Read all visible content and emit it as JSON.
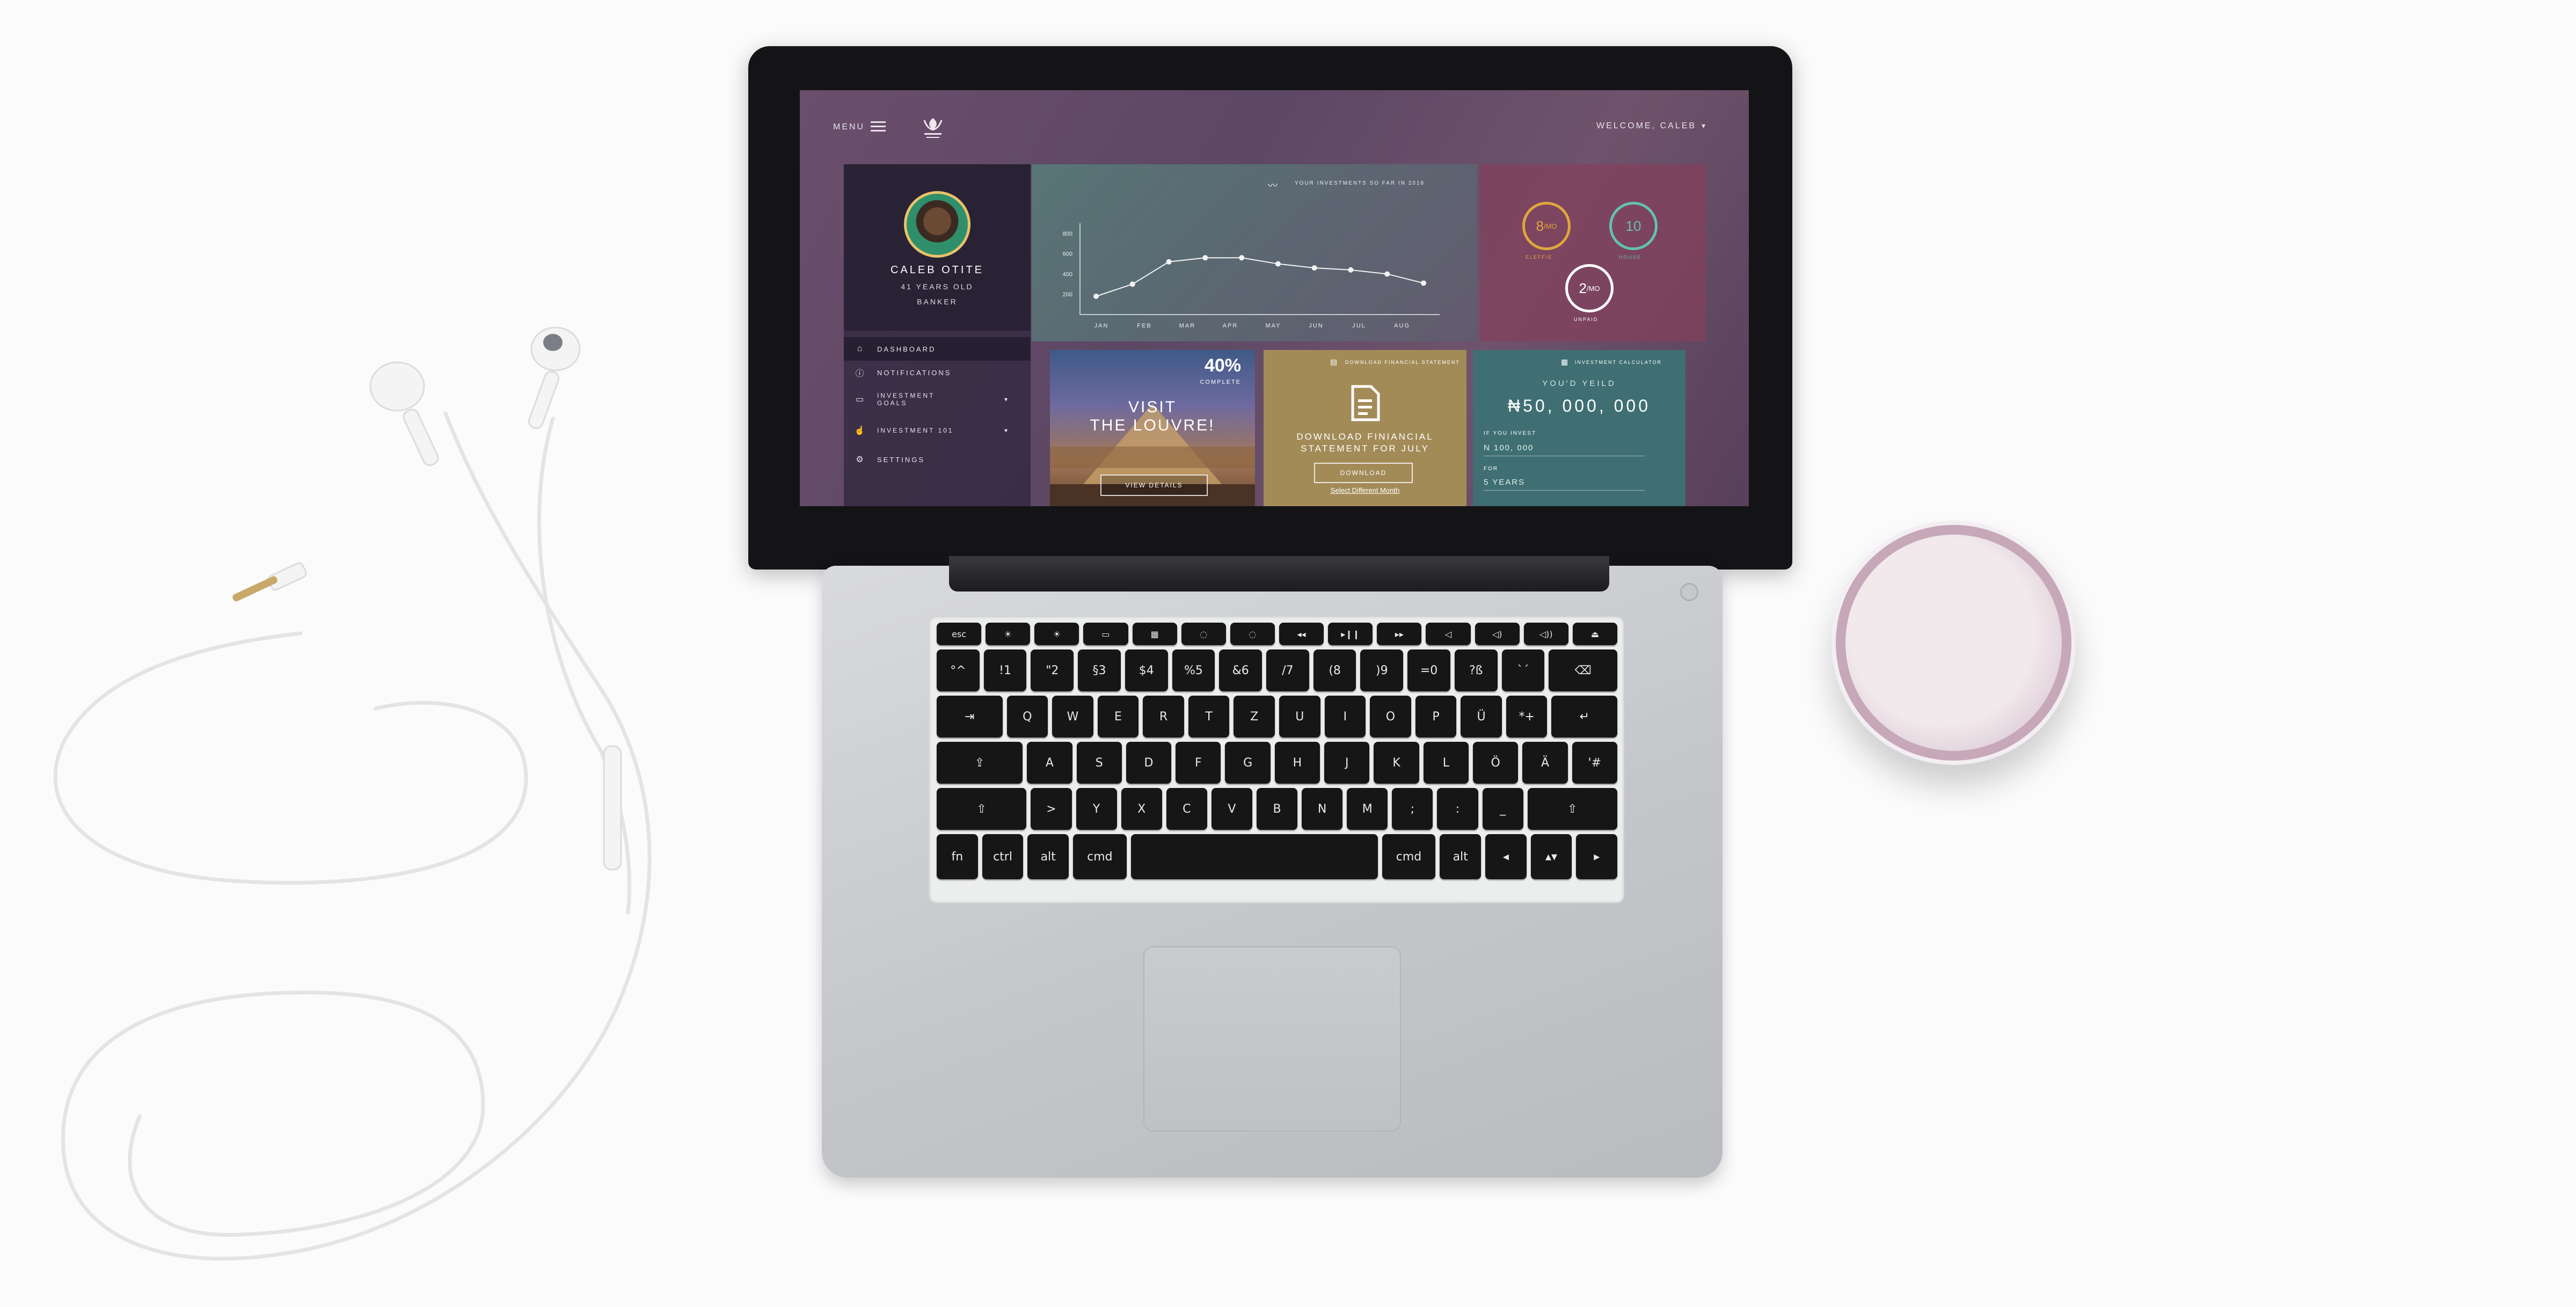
{
  "screen": {
    "header": {
      "menu_label": "MENU",
      "welcome_label": "WELCOME, CALEB"
    },
    "profile": {
      "name": "CALEB OTITE",
      "age": "41 YEARS OLD",
      "job": "BANKER"
    },
    "nav": [
      {
        "label": "DASHBOARD",
        "icon": "home-icon"
      },
      {
        "label": "NOTIFICATIONS",
        "icon": "info-icon"
      },
      {
        "label": "INVESTMENT GOALS",
        "icon": "money-icon"
      },
      {
        "label": "INVESTMENT 101",
        "icon": "hand-icon"
      },
      {
        "label": "SETTINGS",
        "icon": "gear-icon"
      }
    ],
    "chart_card": {
      "title": "YOUR INVESTMENTS SO FAR IN 2016"
    },
    "goals": [
      {
        "value": "8",
        "unit": "MO",
        "label": "ELEFFIE",
        "color": "#e0a63a"
      },
      {
        "value": "10",
        "unit": "",
        "label": "HOUSE",
        "color": "#62c2b0"
      },
      {
        "value": "2",
        "unit": "MO",
        "label": "UNPAID",
        "color": "#ffffff"
      }
    ],
    "louvre": {
      "percent": "40%",
      "complete": "COMPLETE",
      "title_1": "VISIT",
      "title_2": "THE LOUVRE!",
      "button": "VIEW DETAILS"
    },
    "download": {
      "header": "DOWNLOAD FINANCIAL STATEMENT",
      "text_1": "DOWNLOAD FINIANCIAL",
      "text_2": "STATEMENT FOR JULY",
      "button": "DOWNLOAD",
      "link": "Select Different Month"
    },
    "calc": {
      "header": "INVESTMENT CALCULATOR",
      "yield_label": "YOU'D YEILD",
      "yield_value": "₦50, 000, 000",
      "invest_label": "IF YOU INVEST",
      "invest_value": "N 100, 000",
      "for_label": "FOR",
      "for_value": "5 YEARS"
    }
  },
  "chart_data": {
    "type": "line",
    "title": "YOUR INVESTMENTS SO FAR IN 2016",
    "categories": [
      "JAN",
      "FEB",
      "MAR",
      "APR",
      "MAY",
      "JUN",
      "JUL",
      "AUG"
    ],
    "y_ticks": [
      "800",
      "600",
      "400",
      "200"
    ],
    "ylim": [
      0,
      900
    ],
    "series": [
      {
        "values": [
          180,
          300,
          520,
          560,
          560,
          500,
          460,
          440,
          400,
          310
        ]
      }
    ],
    "x_points": 10
  },
  "keyboard": {
    "rows": [
      [
        "esc",
        "☀",
        "☀",
        "▭",
        "▦",
        "◌",
        "◌",
        "◂◂",
        "▸❙❙",
        "▸▸",
        "◁",
        "◁)",
        "◁))",
        "⏏"
      ],
      [
        "°^",
        "!1",
        "\"2",
        "§3",
        "$4",
        "%5",
        "&6",
        "/7",
        "(8",
        ")9",
        "=0",
        "?ß",
        "`´",
        "⌫"
      ],
      [
        "⇥",
        "Q",
        "W",
        "E",
        "R",
        "T",
        "Z",
        "U",
        "I",
        "O",
        "P",
        "Ü",
        "*+",
        "↵"
      ],
      [
        "⇪",
        "A",
        "S",
        "D",
        "F",
        "G",
        "H",
        "J",
        "K",
        "L",
        "Ö",
        "Ä",
        "'#"
      ],
      [
        "⇧",
        ">",
        "Y",
        "X",
        "C",
        "V",
        "B",
        "N",
        "M",
        ";",
        ":",
        "_",
        "⇧"
      ],
      [
        "fn",
        "ctrl",
        "alt",
        "cmd",
        "",
        "cmd",
        "alt",
        "◂",
        "▴▾",
        "▸"
      ]
    ]
  }
}
